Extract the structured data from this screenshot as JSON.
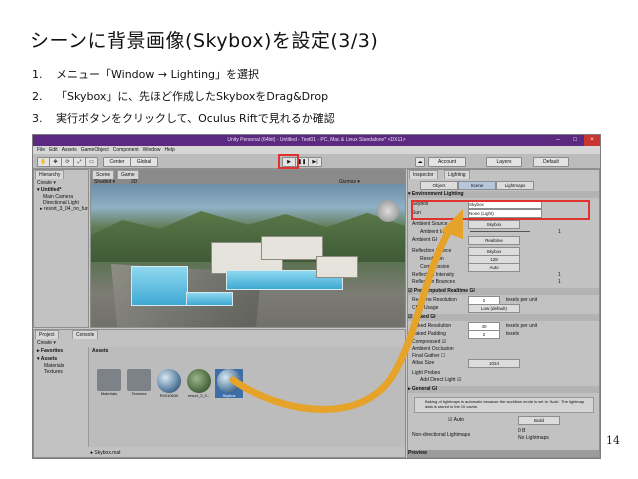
{
  "slide": {
    "title": "シーンに背景画像(Skybox)を設定(3/3)",
    "steps": [
      {
        "num": "1.",
        "text": "メニュー「Window → Lighting」を選択"
      },
      {
        "num": "2.",
        "text": "「Skybox」に、先ほど作成したSkyboxをDrag&Drop"
      },
      {
        "num": "3.",
        "text": "実行ボタンをクリックして、Oculus Riftで見れるか確認"
      }
    ],
    "page_number": "14"
  },
  "unity": {
    "window_title": "Unity Personal (64bit) - Untitled - Test01 - PC, Mac & Linux Standalone* <DX11>",
    "menu": [
      "File",
      "Edit",
      "Assets",
      "GameObject",
      "Component",
      "Window",
      "Help"
    ],
    "toolbar": {
      "center": "Center",
      "global": "Global",
      "account": "Account",
      "layers": "Layers",
      "layout": "Default"
    },
    "hierarchy": {
      "tab": "Hierarchy",
      "create": "Create",
      "scene": "Untitled*",
      "items": [
        "Main Camera",
        "Directional Light",
        "resort_3_04_no_furniture"
      ]
    },
    "scene_view": {
      "tab_scene": "Scene",
      "tab_game": "Game",
      "shaded": "Shaded",
      "mode_2d": "2D",
      "gizmos": "Gizmos"
    },
    "project": {
      "tab_project": "Project",
      "tab_console": "Console",
      "create": "Create",
      "favorites": "Favorites",
      "assets_header": "Assets",
      "tree": [
        "Assets",
        "Materials",
        "Textures"
      ],
      "breadcrumb": "Assets",
      "items": [
        "Materials",
        "Textures",
        "R0010630",
        "resort_3_0...",
        "Skybox"
      ],
      "status_file": "Skybox.mat"
    },
    "inspector": {
      "tab_inspector": "Inspector",
      "tab_lighting": "Lighting",
      "sub_tabs": [
        "Object",
        "Scene",
        "Lightmaps"
      ],
      "environment_header": "Environment Lighting",
      "skybox_label": "Skybox",
      "skybox_value": "Skybox",
      "sun_label": "Sun",
      "sun_value": "None (Light)",
      "ambient_source_label": "Ambient Source",
      "ambient_source_value": "Skybox",
      "ambient_intensity_label": "Ambient Intensity",
      "ambient_intensity_value": "1",
      "ambient_gi_label": "Ambient GI",
      "ambient_gi_value": "Realtime",
      "reflection_source_label": "Reflection Source",
      "reflection_source_value": "Skybox",
      "resolution_label": "Resolution",
      "resolution_value": "128",
      "compression_label": "Compression",
      "compression_value": "Auto",
      "reflection_intensity_label": "Reflection Intensity",
      "reflection_intensity_value": "1",
      "reflection_bounces_label": "Reflection Bounces",
      "reflection_bounces_value": "1",
      "precomputed_header": "Precomputed Realtime GI",
      "realtime_resolution_label": "Realtime Resolution",
      "realtime_resolution_value": "2",
      "texels_per_unit": "texels per unit",
      "cpu_usage_label": "CPU Usage",
      "cpu_usage_value": "Low (default)",
      "baked_header": "Baked GI",
      "baked_resolution_label": "Baked Resolution",
      "baked_resolution_value": "40",
      "baked_padding_label": "Baked Padding",
      "baked_padding_value": "2",
      "texels": "texels",
      "compressed_label": "Compressed",
      "ambient_occlusion_label": "Ambient Occlusion",
      "final_gather_label": "Final Gather",
      "atlas_size_label": "Atlas Size",
      "atlas_size_value": "1024",
      "light_probes": "Light Probes",
      "add_direct_light": "Add Direct Light",
      "general_header": "General GI",
      "info_text": "Baking of lightmaps is automatic because the workflow mode is set to 'Auto'. The lightmap data is stored in the GI cache.",
      "auto_label": "Auto",
      "build_button": "Build",
      "non_directional": "Non-directional Lightmaps",
      "zero_b": "0 B",
      "no_lightmaps": "No Lightmaps",
      "preview": "Preview"
    }
  },
  "colors": {
    "titlebar": "#5b2a80",
    "highlight": "#e0332f",
    "arrow": "#e5a32a",
    "selection": "#3d6ea8"
  }
}
